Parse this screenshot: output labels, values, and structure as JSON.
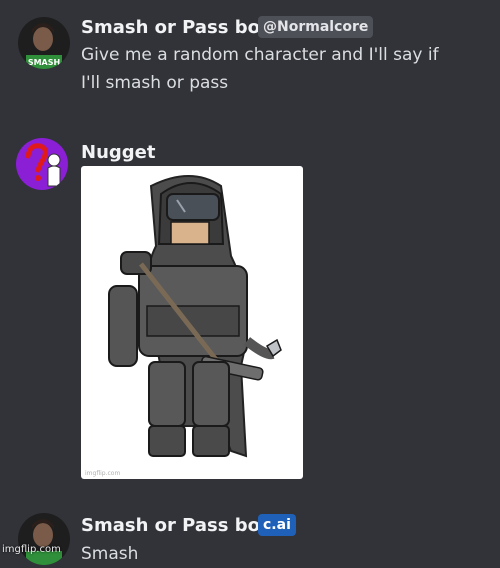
{
  "messages": [
    {
      "author": "Smash or Pass bot",
      "tag": "@Normalcore",
      "text_line1": "Give me a random character and I'll say if",
      "text_line2": "I'll smash or pass"
    },
    {
      "author": "Nugget",
      "attachment_watermark": "imgflip.com"
    },
    {
      "author": "Smash or Pass bot",
      "tag": "c.ai",
      "text": "Smash"
    }
  ],
  "avatar_caption": "SMASH",
  "site_watermark": "imgflip.com",
  "colors": {
    "background": "#313338",
    "tag_blue": "#1f61b8",
    "tag_gray": "#4e5058"
  }
}
